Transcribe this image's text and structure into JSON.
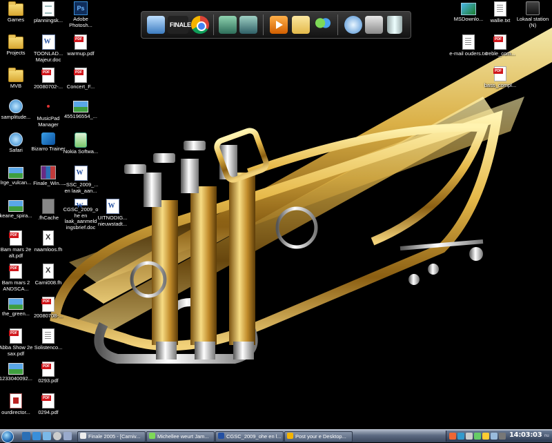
{
  "desktop": {
    "left_column_1": [
      {
        "label": "Games",
        "icon": "folder-icon"
      },
      {
        "label": "Projects",
        "icon": "folder-icon"
      },
      {
        "label": "MVB",
        "icon": "folder-icon"
      },
      {
        "label": "samplitude...",
        "icon": "samplitude-icon"
      },
      {
        "label": "Safari",
        "icon": "safari-icon"
      },
      {
        "label": "lrge_vulcan...",
        "icon": "image-icon"
      },
      {
        "label": "keane_spira...",
        "icon": "image-icon"
      },
      {
        "label": "Bam mars 2e alt.pdf",
        "icon": "pdf-icon"
      },
      {
        "label": "Bam mars 2 ANDSCA...",
        "icon": "pdf-icon"
      },
      {
        "label": "the_green...",
        "icon": "image-icon"
      },
      {
        "label": "Abba Show 2e sax.pdf",
        "icon": "pdf-icon"
      },
      {
        "label": "1233040092...",
        "icon": "image-icon"
      },
      {
        "label": "ourdirector...",
        "icon": "database-icon"
      }
    ],
    "left_column_2": [
      {
        "label": "planningsk...",
        "icon": "document-icon"
      },
      {
        "label": "TOONLAD... Majeur.doc",
        "icon": "word-icon"
      },
      {
        "label": "20080702-...",
        "icon": "pdf-icon"
      },
      {
        "label": "MusicPad Manager",
        "icon": "musicpad-icon"
      },
      {
        "label": "Bizarro Trainer",
        "icon": "bizarro-icon"
      },
      {
        "label": "Finale_Win...",
        "icon": "archive-icon"
      },
      {
        "label": ".fhCache",
        "icon": "file-icon"
      },
      {
        "label": "naamloos.fh",
        "icon": "freehand-icon"
      },
      {
        "label": "Carni008.fh",
        "icon": "freehand-icon"
      },
      {
        "label": "20080708-...",
        "icon": "pdf-icon"
      },
      {
        "label": "Solistenco...",
        "icon": "text-file-icon"
      },
      {
        "label": "0293.pdf",
        "icon": "pdf-icon"
      },
      {
        "label": "0294.pdf",
        "icon": "pdf-icon"
      }
    ],
    "left_column_3": [
      {
        "label": "Adobe Photosh...",
        "icon": "photoshop-icon"
      },
      {
        "label": "warmup.pdf",
        "icon": "pdf-icon"
      },
      {
        "label": "Concert_F...",
        "icon": "pdf-icon"
      },
      {
        "label": "455196554_...",
        "icon": "image-icon"
      },
      {
        "label": "Nokia Softwa...",
        "icon": "nokia-icon"
      },
      {
        "label": "~SSC_2009_... en laak_aan...",
        "icon": "word-icon"
      },
      {
        "label": "CGSC_2009_o he en laak_aanmeld ingsbrief.doc",
        "icon": "word-icon"
      }
    ],
    "left_column_4": [
      {
        "label": "UITNODIG... nieuwstadt...",
        "icon": "word-icon"
      }
    ],
    "right_icons": [
      {
        "label": "MSDownlo...",
        "icon": "msdownload-icon"
      },
      {
        "label": "wallie.txt",
        "icon": "text-file-icon"
      },
      {
        "label": "Lokaal station (N)",
        "icon": "drive-icon"
      },
      {
        "label": "e-mail ouders.txt",
        "icon": "text-file-icon"
      },
      {
        "label": "treble_com...",
        "icon": "pdf-icon"
      },
      {
        "label": "bass_compl...",
        "icon": "pdf-icon"
      }
    ]
  },
  "dock": {
    "items": [
      {
        "name": "computer",
        "icon": "computer-icon"
      },
      {
        "name": "finale",
        "icon": "finale-icon",
        "label": "FINALE"
      },
      {
        "name": "chrome",
        "icon": "chrome-icon"
      },
      {
        "name": "window-manager",
        "icon": "window-icon"
      },
      {
        "name": "window-manager-2",
        "icon": "window-icon"
      },
      {
        "name": "media-player",
        "icon": "play-icon"
      },
      {
        "name": "folder",
        "icon": "folder-icon"
      },
      {
        "name": "messenger",
        "icon": "messenger-icon"
      },
      {
        "name": "itunes",
        "icon": "itunes-icon"
      },
      {
        "name": "devices",
        "icon": "devices-icon"
      },
      {
        "name": "recycle-bin",
        "icon": "trash-icon"
      }
    ]
  },
  "taskbar": {
    "tasks": [
      {
        "label": "Finale 2005 - [Carniv...",
        "icon": "finale-icon"
      },
      {
        "label": "Michellee weurt Jam...",
        "icon": "messenger-icon"
      },
      {
        "label": "CGSC_2009_ohe en l...",
        "icon": "word-icon"
      },
      {
        "label": "Post your e Desktop...",
        "icon": "browser-icon"
      }
    ],
    "clock": "14:03:03",
    "clock_suffix": "nu"
  },
  "colors": {
    "taskbar": "#4c5b74",
    "dock": "#1e1e1e",
    "brass": "#d6a93a"
  }
}
